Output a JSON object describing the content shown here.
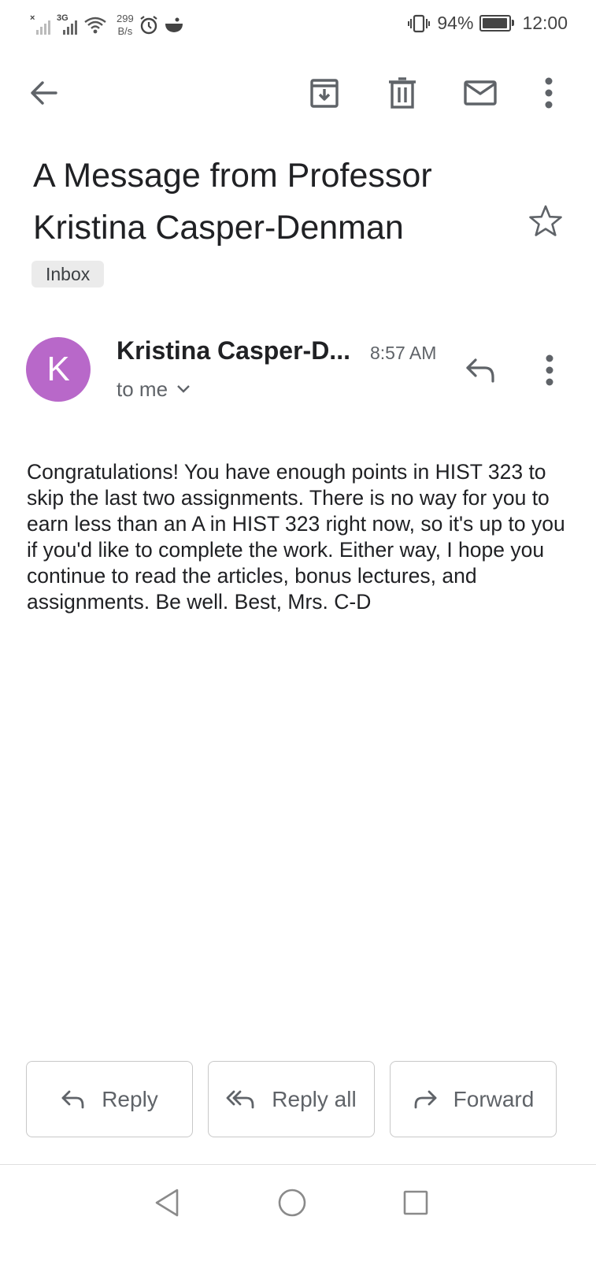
{
  "status_bar": {
    "network_tag": "3G",
    "net_speed_value": "299",
    "net_speed_unit": "B/s",
    "battery_percent": "94%",
    "battery_level": 0.94,
    "time": "12:00"
  },
  "toolbar": {
    "back_icon": "arrow-left-icon",
    "archive_icon": "archive-icon",
    "delete_icon": "trash-icon",
    "mark_unread_icon": "mail-icon",
    "more_icon": "more-vert-icon"
  },
  "email": {
    "subject": "A Message from Professor Kristina Casper-Denman",
    "label": "Inbox",
    "starred": false,
    "avatar_letter": "K",
    "avatar_color": "#b868c9",
    "sender": "Kristina Casper-D...",
    "time": "8:57 AM",
    "recipient": "to me",
    "body": "Congratulations! You have enough points in HIST 323 to skip the last two assignments. There is no way for you to earn less than an A in HIST 323 right now, so it's up to you if you'd like to complete the work. Either way, I hope you continue to read the articles, bonus lectures, and assignments. Be well. Best, Mrs. C-D"
  },
  "actions": {
    "reply": "Reply",
    "reply_all": "Reply all",
    "forward": "Forward"
  },
  "colors": {
    "text_primary": "#202124",
    "text_secondary": "#5f6368",
    "chip_bg": "#ebebeb"
  }
}
